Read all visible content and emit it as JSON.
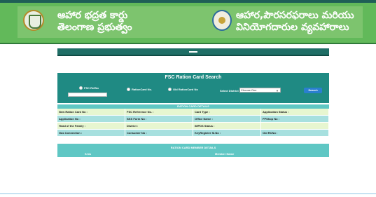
{
  "header": {
    "left_title_line1": "ఆహార భద్రత కార్డు",
    "left_title_line2": "తెలంగాణ ప్రభుత్వం",
    "right_title_line1": "ఆహార,పౌరసరఫరాలు మరియు",
    "right_title_line2": "వినియోగదారుల వ్యవహారాలు"
  },
  "search": {
    "title": "FSC Ration Card Search",
    "options": [
      "FSC RefNo",
      "RationCard No.",
      "Old RationCard No"
    ],
    "district_label": "Select District :",
    "district_value": "Choose One",
    "button_label": "Search"
  },
  "details": {
    "title": "RATION CARD DETAILS",
    "rows": [
      [
        "New Ration Card No :",
        "FSC Reference No. :",
        "Card Type :",
        "Application Status :"
      ],
      [
        "Application No :",
        "SKS Form No :",
        "Office Name :",
        "FPShop No :"
      ],
      [
        "Head of the Family :",
        "District :",
        "IMPDS Status :",
        ""
      ],
      [
        "Gas Connection :",
        "Consumer No :",
        "KeyRegister Sl.No :",
        "Old RCNo :"
      ]
    ]
  },
  "members": {
    "title": "RATION CARD MEMBER DETAILS",
    "columns": [
      "S.No",
      "Member Name"
    ]
  },
  "colors": {
    "header_green": "#62b95a",
    "panel_teal": "#1f8a83",
    "details_teal": "#5fc7c4",
    "search_blue": "#2a7fd0"
  }
}
